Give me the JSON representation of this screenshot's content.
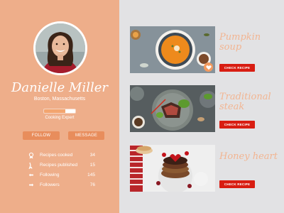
{
  "profile": {
    "name": "Danielle Miller",
    "location": "Boston, Massachusetts",
    "level_label": "Cooking Expert",
    "level_progress": 0.68,
    "follow_label": "FOLLOW",
    "message_label": "MESSAGE"
  },
  "stats": [
    {
      "icon": "medal-icon",
      "label": "Recipes cooked",
      "value": "34"
    },
    {
      "icon": "chef-hat-icon",
      "label": "Recipes published",
      "value": "15"
    },
    {
      "icon": "arrow-left-icon",
      "label": "Following",
      "value": "145"
    },
    {
      "icon": "arrow-right-icon",
      "label": "Followers",
      "value": "76"
    }
  ],
  "recipes": [
    {
      "title": "Pumpkin soup",
      "button_label": "CHECK RECIPE"
    },
    {
      "title": "Traditional steak",
      "button_label": "CHECK RECIPE"
    },
    {
      "title": "Honey heart",
      "button_label": "CHECK RECIPE"
    }
  ],
  "colors": {
    "sidebar": "#eeae8a",
    "accent_button": "#e88d5c",
    "cta_red": "#d81d12",
    "title_peach": "#f2b592",
    "background": "#e2e2e4"
  }
}
